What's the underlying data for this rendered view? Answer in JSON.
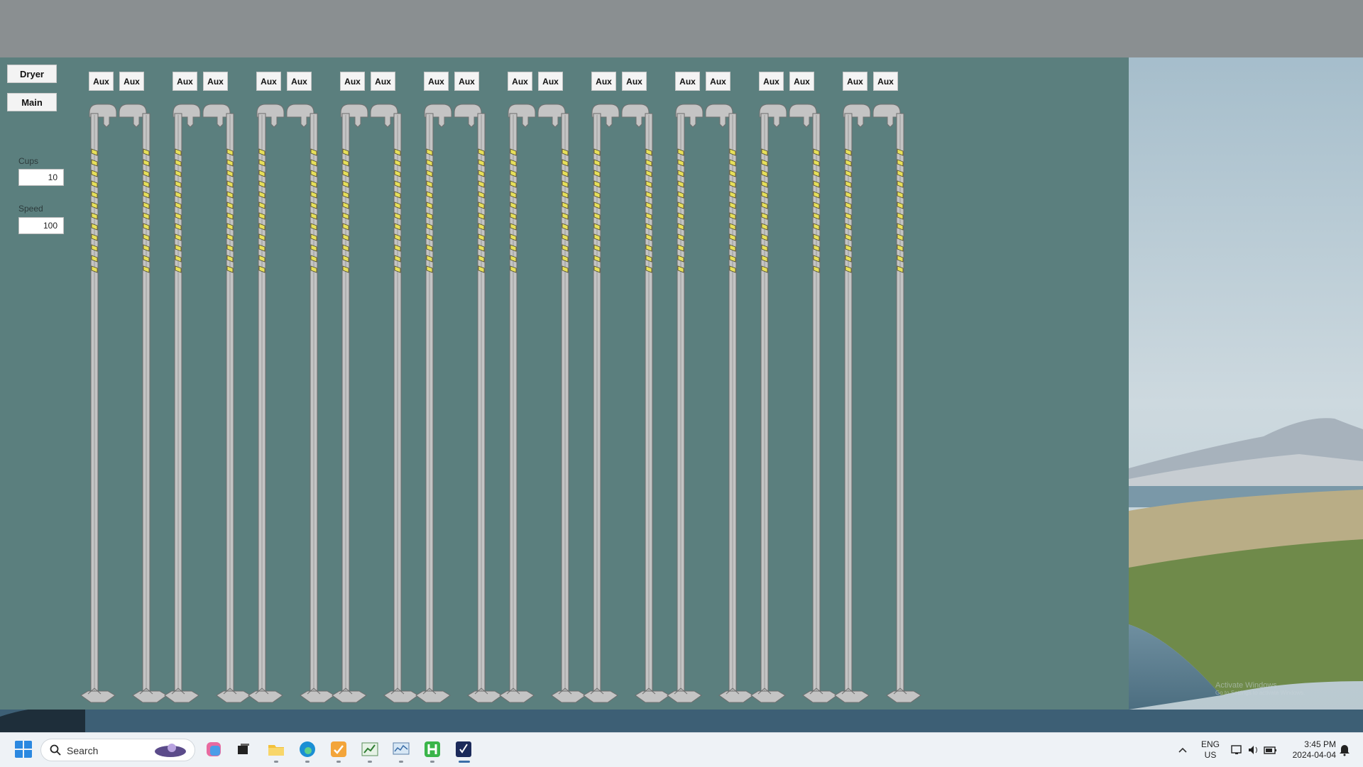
{
  "app": {
    "buttons": {
      "dryer": "Dryer",
      "main": "Main"
    },
    "cups": {
      "label": "Cups",
      "value": "10"
    },
    "speed": {
      "label": "Speed",
      "value": "100"
    },
    "aux_label": "Aux",
    "elevator_count": 10,
    "colors": {
      "background": "#5b7f7e",
      "elevator": "#c4c4c4",
      "bucket": "#e7df5a"
    }
  },
  "desktop": {
    "watermark": {
      "line1": "Activate Windows",
      "line2": "Go to Settings to activate Windows."
    }
  },
  "taskbar": {
    "search_placeholder": "Search",
    "language": {
      "line1": "ENG",
      "line2": "US"
    },
    "clock": {
      "time": "3:45 PM",
      "date": "2024-04-04"
    },
    "apps": [
      "start-icon",
      "copilot-icon",
      "task-view-icon",
      "file-explorer-icon",
      "edge-icon",
      "app-orange-icon",
      "app-chart-icon",
      "app-monitor-icon",
      "app-green-h-icon",
      "app-checkmark-icon"
    ]
  }
}
